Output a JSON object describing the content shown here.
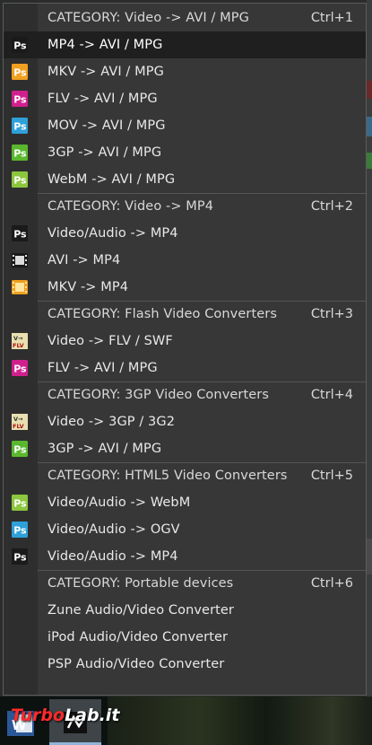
{
  "colors": {
    "menu_bg": "#373737",
    "gutter_bg": "#2e2e2e",
    "selected_bg": "#1f1f1f",
    "text": "#e8e8e8",
    "separator": "#555555",
    "ps_black": "#1a1a1a",
    "ps_orange": "#f0a020",
    "ps_magenta": "#d0208e",
    "ps_blue": "#2fa0d8",
    "ps_green": "#5ab82e",
    "ps_lime": "#8cc63f",
    "flv_bg": "#e8e0b0",
    "flv_text": "#b01010",
    "watermark_red": "#ff2a2a"
  },
  "menu": {
    "items": [
      {
        "label": "CATEGORY:   Video -> AVI / MPG",
        "shortcut": "Ctrl+1",
        "type": "category",
        "icon": "none"
      },
      {
        "label": "MP4 -> AVI / MPG",
        "shortcut": "",
        "type": "item",
        "icon": "ps-black-icon",
        "selected": true
      },
      {
        "label": "MKV -> AVI / MPG",
        "shortcut": "",
        "type": "item",
        "icon": "ps-orange-icon"
      },
      {
        "label": "FLV -> AVI / MPG",
        "shortcut": "",
        "type": "item",
        "icon": "ps-magenta-icon"
      },
      {
        "label": "MOV -> AVI / MPG",
        "shortcut": "",
        "type": "item",
        "icon": "ps-blue-icon"
      },
      {
        "label": "3GP -> AVI / MPG",
        "shortcut": "",
        "type": "item",
        "icon": "ps-green-icon"
      },
      {
        "label": "WebM -> AVI / MPG",
        "shortcut": "",
        "type": "item",
        "icon": "ps-lime-icon"
      },
      {
        "label": "CATEGORY:   Video -> MP4",
        "shortcut": "Ctrl+2",
        "type": "category",
        "icon": "none"
      },
      {
        "label": "Video/Audio -> MP4",
        "shortcut": "",
        "type": "item",
        "icon": "ps-black-icon"
      },
      {
        "label": "AVI -> MP4",
        "shortcut": "",
        "type": "item",
        "icon": "film-strip-icon"
      },
      {
        "label": "MKV -> MP4",
        "shortcut": "",
        "type": "item",
        "icon": "film-orange-icon"
      },
      {
        "label": "CATEGORY:   Flash Video Converters",
        "shortcut": "Ctrl+3",
        "type": "category",
        "icon": "none"
      },
      {
        "label": "Video -> FLV / SWF",
        "shortcut": "",
        "type": "item",
        "icon": "flv-icon"
      },
      {
        "label": "FLV -> AVI / MPG",
        "shortcut": "",
        "type": "item",
        "icon": "ps-magenta-icon"
      },
      {
        "label": "CATEGORY:   3GP Video Converters",
        "shortcut": "Ctrl+4",
        "type": "category",
        "icon": "none"
      },
      {
        "label": "Video -> 3GP / 3G2",
        "shortcut": "",
        "type": "item",
        "icon": "flv-icon"
      },
      {
        "label": "3GP -> AVI / MPG",
        "shortcut": "",
        "type": "item",
        "icon": "ps-green-icon"
      },
      {
        "label": "CATEGORY:   HTML5 Video Converters",
        "shortcut": "Ctrl+5",
        "type": "category",
        "icon": "none"
      },
      {
        "label": "Video/Audio -> WebM",
        "shortcut": "",
        "type": "item",
        "icon": "ps-lime-icon"
      },
      {
        "label": "Video/Audio -> OGV",
        "shortcut": "",
        "type": "item",
        "icon": "ps-blue-icon"
      },
      {
        "label": "Video/Audio -> MP4",
        "shortcut": "",
        "type": "item",
        "icon": "ps-black-icon"
      },
      {
        "label": "CATEGORY:   Portable devices",
        "shortcut": "Ctrl+6",
        "type": "category",
        "icon": "none"
      },
      {
        "label": "Zune Audio/Video Converter",
        "shortcut": "",
        "type": "item",
        "icon": "none"
      },
      {
        "label": "iPod Audio/Video Converter",
        "shortcut": "",
        "type": "item",
        "icon": "none"
      },
      {
        "label": "PSP Audio/Video Converter",
        "shortcut": "",
        "type": "item",
        "icon": "none"
      }
    ]
  },
  "icons": {
    "ps_letters": "Ps",
    "flv_top": "V→",
    "flv_bottom": "FLV"
  },
  "taskbar": {
    "word_icon": "word-icon",
    "active_app_icon": "converter-app-icon"
  },
  "watermark": {
    "part1": "Turbo",
    "part2": "Lab.it"
  }
}
